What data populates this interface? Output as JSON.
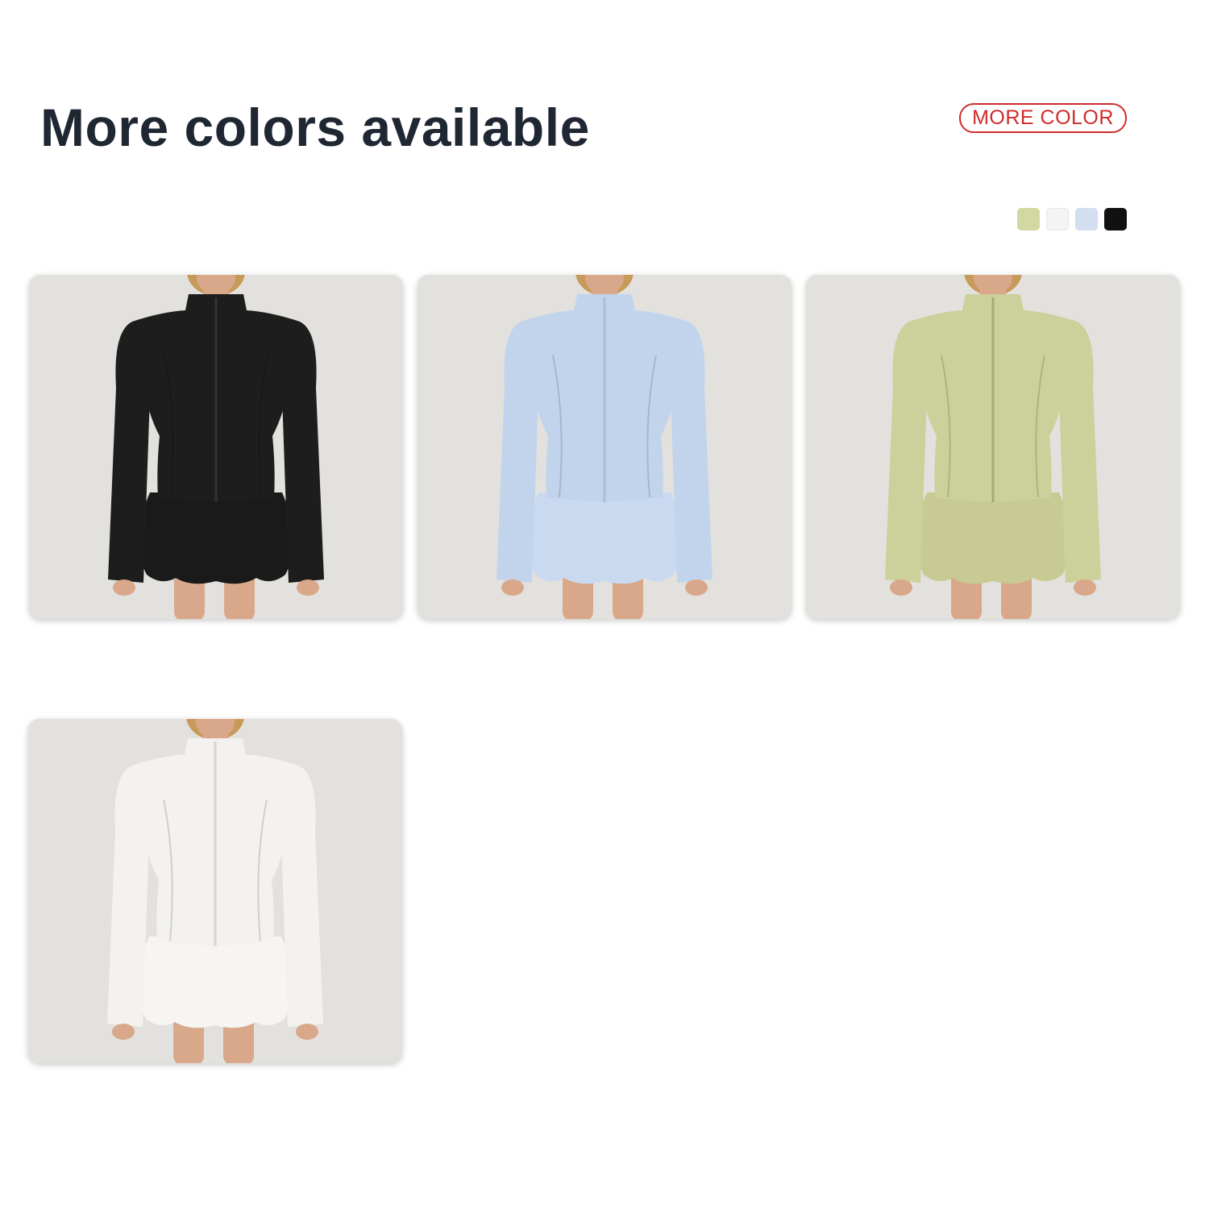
{
  "header": {
    "title": "More colors available",
    "badge_label": "MORE COLOR"
  },
  "swatches": [
    {
      "name": "sage-green",
      "color": "#d3d8a2"
    },
    {
      "name": "white",
      "color": "#f4f4f2"
    },
    {
      "name": "light-blue",
      "color": "#d3dff0"
    },
    {
      "name": "black",
      "color": "#111111"
    }
  ],
  "products": [
    {
      "variant": "black",
      "jacket_color": "#1d1d1d",
      "shorts_color": "#1a1a1a",
      "zip_color": "#333333"
    },
    {
      "variant": "light-blue",
      "jacket_color": "#c2d4ec",
      "shorts_color": "#c9daf0",
      "zip_color": "#a9bdd8"
    },
    {
      "variant": "sage-green",
      "jacket_color": "#ccd09a",
      "shorts_color": "#c7cb93",
      "zip_color": "#a8ac74"
    },
    {
      "variant": "white",
      "jacket_color": "#f3f2ee",
      "shorts_color": "#f6f5f1",
      "zip_color": "#d8d6cf"
    }
  ],
  "colors": {
    "title": "#1f2733",
    "badge": "#d02b2b",
    "card_bg": "#e3e1dd",
    "skin": "#d9a88a",
    "hair": "#c89a5a"
  }
}
